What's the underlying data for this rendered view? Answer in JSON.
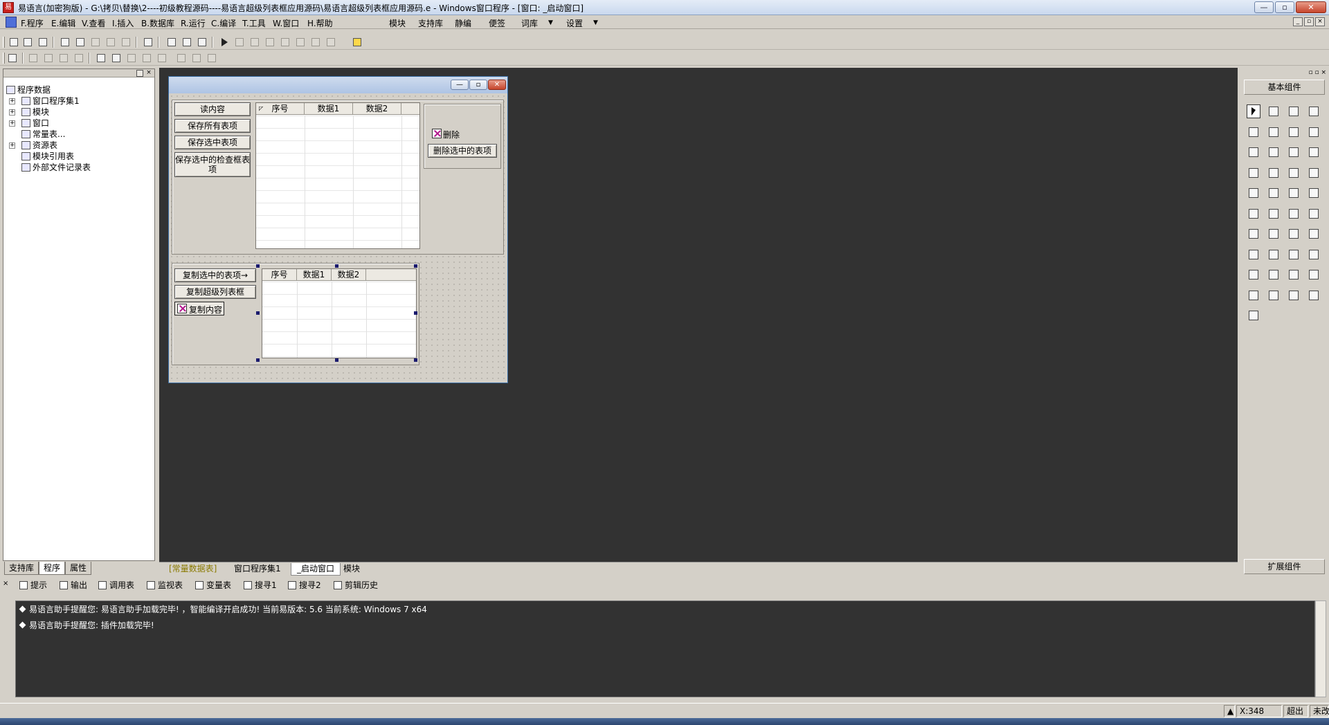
{
  "window": {
    "title": "易语言(加密狗版) - G:\\拷贝\\替换\\2----初级教程源码----易语言超级列表框应用源码\\易语言超级列表框应用源码.e - Windows窗口程序 - [窗口: _启动窗口]",
    "min": "—",
    "max": "▫",
    "close": "✕"
  },
  "menu": {
    "items": [
      "F.程序",
      "E.编辑",
      "V.查看",
      "I.插入",
      "B.数据库",
      "R.运行",
      "C.编译",
      "T.工具",
      "W.窗口",
      "H.帮助"
    ],
    "extra": [
      "模块",
      "支持库",
      "静编",
      "便签",
      "词库",
      "▼",
      "设置",
      "▼"
    ]
  },
  "left_panel": {
    "tree": {
      "root": "程序数据",
      "items": [
        "窗口程序集1",
        "模块",
        "窗口",
        "常量表...",
        "资源表",
        "模块引用表",
        "外部文件记录表"
      ]
    },
    "tabs": [
      "支持库",
      "程序",
      "属性"
    ]
  },
  "designer": {
    "buttons_top": [
      "读内容",
      "保存所有表项",
      "保存选中表项",
      "保存选中的检查框表项"
    ],
    "grid1_headers": [
      "序号",
      "数据1",
      "数据2"
    ],
    "delete_checkbox": "删除",
    "delete_selected": "删除选中的表项",
    "buttons_bottom": [
      "复制选中的表项→",
      "复制超级列表框"
    ],
    "copy_checkbox": "复制内容",
    "grid2_headers": [
      "序号",
      "数据1",
      "数据2"
    ]
  },
  "editor_tabs": [
    "[常量数据表]",
    "窗口程序集1",
    "_启动窗口",
    "模块"
  ],
  "right_panel": {
    "title": "基本组件",
    "footer": "扩展组件"
  },
  "output_tabs": [
    "提示",
    "输出",
    "调用表",
    "监视表",
    "变量表",
    "搜寻1",
    "搜寻2",
    "剪辑历史"
  ],
  "output_lines": [
    "易语言助手提醒您: 易语言助手加载完毕! ，智能编译开启成功! 当前易版本: 5.6  当前系统: Windows 7 x64",
    "易语言助手提醒您: 插件加载完毕!"
  ],
  "status": {
    "coords": "X:348",
    "ins": "超出",
    "mod": "未改"
  }
}
